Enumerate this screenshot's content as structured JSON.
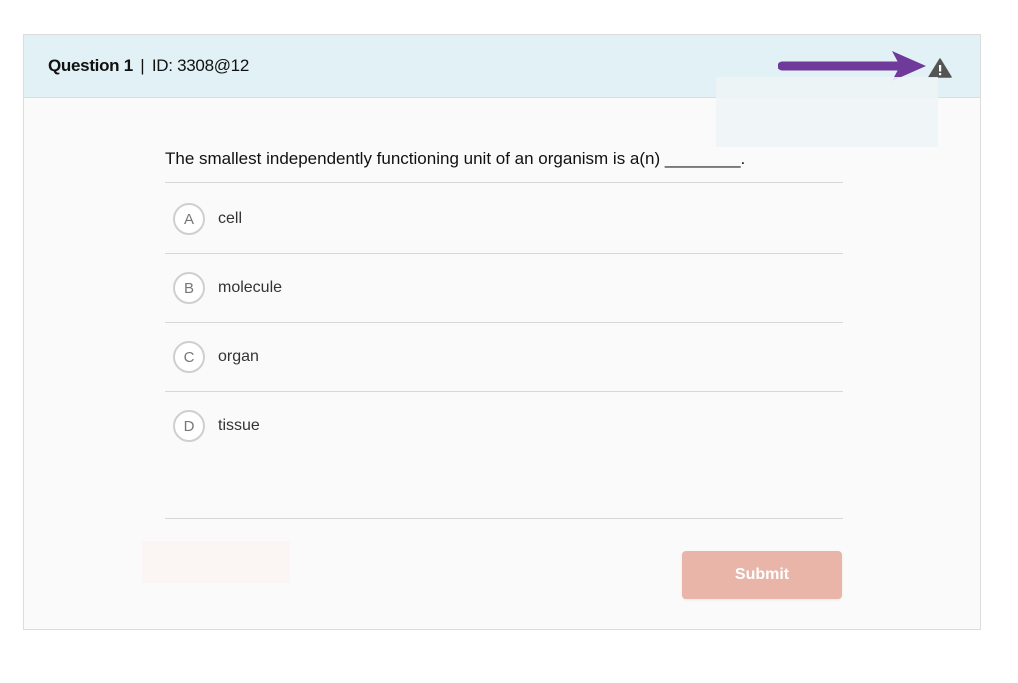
{
  "header": {
    "question_label": "Question 1",
    "separator": "|",
    "id_text": "ID: 3308@12",
    "warning_icon": "warning-triangle-icon",
    "annotation_arrow_color": "#6f3a9a"
  },
  "question": {
    "text": "The smallest independently functioning unit of an organism is a(n) ________."
  },
  "options": [
    {
      "letter": "A",
      "text": "cell"
    },
    {
      "letter": "B",
      "text": "molecule"
    },
    {
      "letter": "C",
      "text": "organ"
    },
    {
      "letter": "D",
      "text": "tissue"
    }
  ],
  "footer": {
    "submit_label": "Submit",
    "submit_color": "#e8b5a8"
  }
}
